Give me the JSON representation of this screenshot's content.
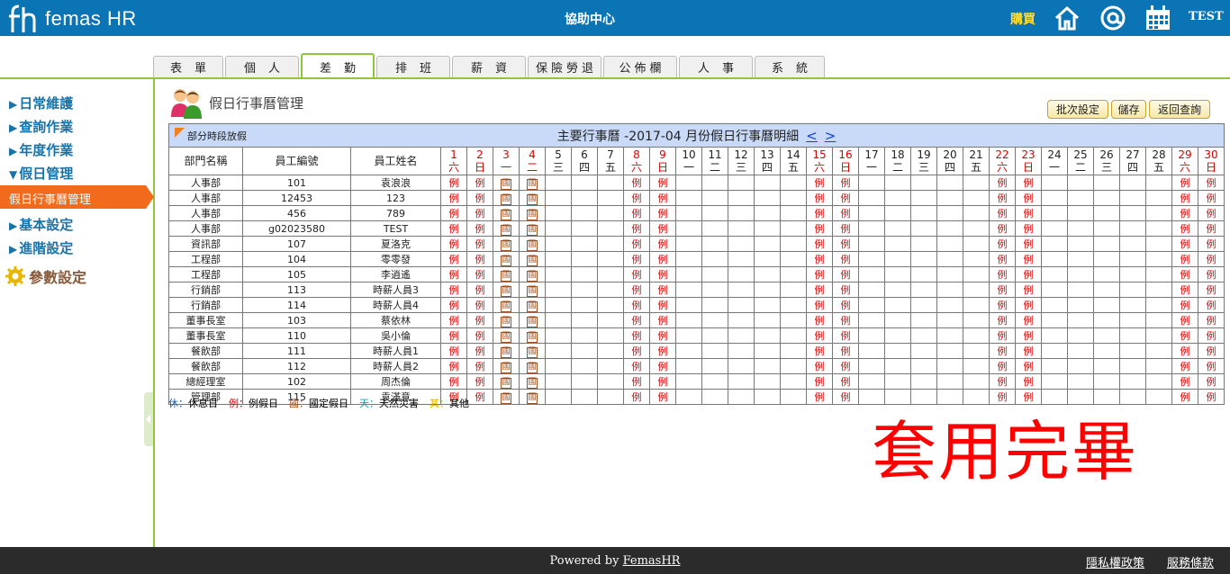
{
  "header": {
    "logo_text": "femas HR",
    "center_title": "協助中心",
    "buy_label": "購買",
    "user": "TEST",
    "icons": [
      "home-icon",
      "at-sign-icon",
      "calendar-icon"
    ]
  },
  "tabs": [
    "表單",
    "個人",
    "差勤",
    "排班",
    "薪資",
    "保險勞退",
    "公佈欄",
    "人事",
    "系統"
  ],
  "active_tab": "差勤",
  "sidebar": {
    "items": [
      "日常維護",
      "查詢作業",
      "年度作業",
      "假日管理",
      "假日行事曆管理",
      "基本設定",
      "進階設定",
      "參數設定"
    ]
  },
  "page": {
    "title": "假日行事曆管理",
    "buttons": {
      "batch": "批次設定",
      "save": "儲存",
      "back": "返回查詢"
    }
  },
  "calendar": {
    "partial_label": "部分時段放假",
    "title": "主要行事曆 -2017-04 月份假日行事曆明細",
    "prev": "<",
    "next": ">",
    "col_headers": [
      "部門名稱",
      "員工編號",
      "員工姓名"
    ],
    "days": [
      {
        "d": "1",
        "w": "六",
        "red": true
      },
      {
        "d": "2",
        "w": "日",
        "red": true
      },
      {
        "d": "3",
        "w": "一",
        "red": true
      },
      {
        "d": "4",
        "w": "二",
        "red": true
      },
      {
        "d": "5",
        "w": "三",
        "red": false
      },
      {
        "d": "6",
        "w": "四",
        "red": false
      },
      {
        "d": "7",
        "w": "五",
        "red": false
      },
      {
        "d": "8",
        "w": "六",
        "red": true
      },
      {
        "d": "9",
        "w": "日",
        "red": true
      },
      {
        "d": "10",
        "w": "一",
        "red": false
      },
      {
        "d": "11",
        "w": "二",
        "red": false
      },
      {
        "d": "12",
        "w": "三",
        "red": false
      },
      {
        "d": "13",
        "w": "四",
        "red": false
      },
      {
        "d": "14",
        "w": "五",
        "red": false
      },
      {
        "d": "15",
        "w": "六",
        "red": true
      },
      {
        "d": "16",
        "w": "日",
        "red": true
      },
      {
        "d": "17",
        "w": "一",
        "red": false
      },
      {
        "d": "18",
        "w": "二",
        "red": false
      },
      {
        "d": "19",
        "w": "三",
        "red": false
      },
      {
        "d": "20",
        "w": "四",
        "red": false
      },
      {
        "d": "21",
        "w": "五",
        "red": false
      },
      {
        "d": "22",
        "w": "六",
        "red": true
      },
      {
        "d": "23",
        "w": "日",
        "red": true
      },
      {
        "d": "24",
        "w": "一",
        "red": false
      },
      {
        "d": "25",
        "w": "二",
        "red": false
      },
      {
        "d": "26",
        "w": "三",
        "red": false
      },
      {
        "d": "27",
        "w": "四",
        "red": false
      },
      {
        "d": "28",
        "w": "五",
        "red": false
      },
      {
        "d": "29",
        "w": "六",
        "red": true
      },
      {
        "d": "30",
        "w": "日",
        "red": true
      }
    ],
    "day_marks": [
      "例",
      "例",
      "國",
      "國",
      "",
      "",
      "",
      "例",
      "例",
      "",
      "",
      "",
      "",
      "",
      "例",
      "例",
      "",
      "",
      "",
      "",
      "",
      "例",
      "例",
      "",
      "",
      "",
      "",
      "",
      "例",
      "例"
    ],
    "rows": [
      {
        "dept": "人事部",
        "id": "101",
        "name": "袁浪浪"
      },
      {
        "dept": "人事部",
        "id": "12453",
        "name": "123"
      },
      {
        "dept": "人事部",
        "id": "456",
        "name": "789"
      },
      {
        "dept": "人事部",
        "id": "g02023580",
        "name": "TEST"
      },
      {
        "dept": "資訊部",
        "id": "107",
        "name": "夏洛克"
      },
      {
        "dept": "工程部",
        "id": "104",
        "name": "零零發"
      },
      {
        "dept": "工程部",
        "id": "105",
        "name": "李逍遙"
      },
      {
        "dept": "行銷部",
        "id": "113",
        "name": "時薪人員3"
      },
      {
        "dept": "行銷部",
        "id": "114",
        "name": "時薪人員4"
      },
      {
        "dept": "董事長室",
        "id": "103",
        "name": "蔡依林"
      },
      {
        "dept": "董事長室",
        "id": "110",
        "name": "吳小倫"
      },
      {
        "dept": "餐飲部",
        "id": "111",
        "name": "時薪人員1"
      },
      {
        "dept": "餐飲部",
        "id": "112",
        "name": "時薪人員2"
      },
      {
        "dept": "總經理室",
        "id": "102",
        "name": "周杰倫"
      },
      {
        "dept": "管理部",
        "id": "115",
        "name": "袁滿意"
      }
    ]
  },
  "legend": [
    {
      "key": "休",
      "label": "休息日",
      "color": "#1a5fb4"
    },
    {
      "key": "例",
      "label": "例假日",
      "color": "#d00000"
    },
    {
      "key": "國",
      "label": "國定假日",
      "color": "#a05020"
    },
    {
      "key": "天",
      "label": "天然災害",
      "color": "#1a9fb4"
    },
    {
      "key": "其",
      "label": "其他",
      "color": "#e0b000"
    }
  ],
  "overlay_text": "套用完畢",
  "footer": {
    "powered_prefix": "Powered by ",
    "powered_link": "FemasHR",
    "privacy": "隱私權政策",
    "terms": "服務條款"
  }
}
